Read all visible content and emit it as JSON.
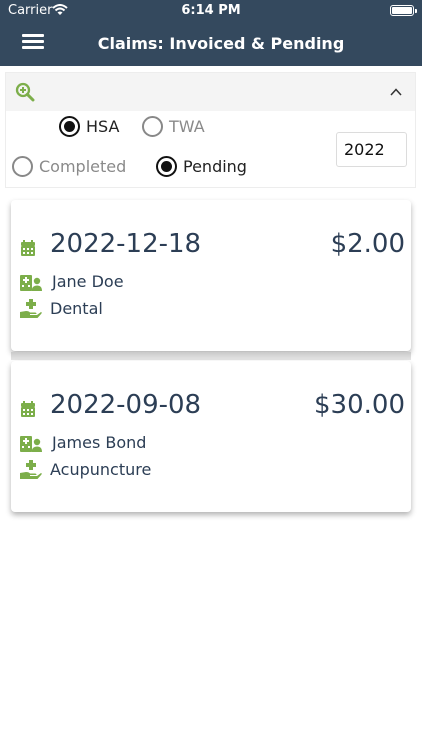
{
  "status_bar": {
    "carrier": "Carrier",
    "time": "6:14 PM"
  },
  "nav": {
    "title": "Claims: Invoiced & Pending"
  },
  "filter": {
    "account_options": [
      {
        "label": "HSA",
        "selected": true
      },
      {
        "label": "TWA",
        "selected": false
      }
    ],
    "status_options": [
      {
        "label": "Completed",
        "selected": false
      },
      {
        "label": "Pending",
        "selected": true
      }
    ],
    "year": "2022"
  },
  "claims": [
    {
      "date": "2022-12-18",
      "amount": "$2.00",
      "person": "Jane Doe",
      "category": "Dental"
    },
    {
      "date": "2022-09-08",
      "amount": "$30.00",
      "person": "James Bond",
      "category": "Acupuncture"
    }
  ],
  "colors": {
    "header": "#34495e",
    "accent": "#7cae4a",
    "text": "#2c3e55"
  }
}
